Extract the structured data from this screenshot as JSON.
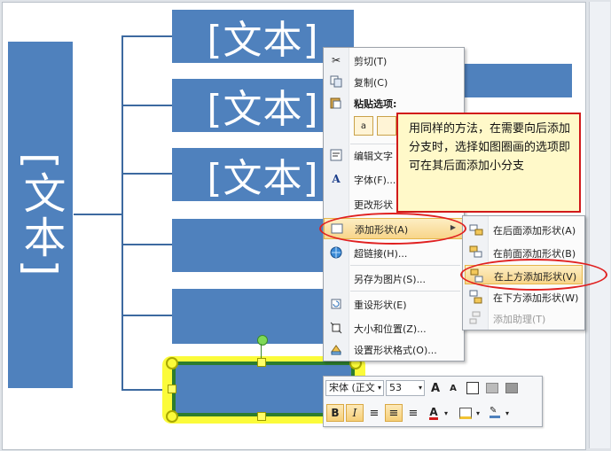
{
  "smartart": {
    "root_text": "[文本]",
    "branch_texts": [
      "[文本]",
      "[文本]",
      "[文本]",
      "",
      "",
      ""
    ]
  },
  "context_menu": {
    "items": [
      {
        "label": "剪切(T)",
        "icon": "scissors-icon"
      },
      {
        "label": "复制(C)",
        "icon": "copy-icon"
      },
      {
        "label": "粘贴选项:",
        "icon": "paste-icon"
      },
      {
        "label": "编辑文字",
        "icon": "edit-text-icon"
      },
      {
        "label": "字体(F)...",
        "icon": "font-icon"
      },
      {
        "label": "更改形状",
        "icon": "change-shape-icon"
      },
      {
        "label": "添加形状(A)",
        "icon": "add-shape-icon"
      },
      {
        "label": "超链接(H)...",
        "icon": "hyperlink-icon"
      },
      {
        "label": "另存为图片(S)...",
        "icon": ""
      },
      {
        "label": "重设形状(E)",
        "icon": "reset-shape-icon"
      },
      {
        "label": "大小和位置(Z)...",
        "icon": "size-position-icon"
      },
      {
        "label": "设置形状格式(O)...",
        "icon": "format-shape-icon"
      }
    ]
  },
  "submenu": {
    "items": [
      {
        "label": "在后面添加形状(A)",
        "disabled": false
      },
      {
        "label": "在前面添加形状(B)",
        "disabled": false
      },
      {
        "label": "在上方添加形状(V)",
        "disabled": false
      },
      {
        "label": "在下方添加形状(W)",
        "disabled": false
      },
      {
        "label": "添加助理(T)",
        "disabled": true
      }
    ]
  },
  "callout": {
    "text": "用同样的方法，在需要向后添加分支时，选择如图圈画的选项即可在其后面添加小分支"
  },
  "mini_toolbar": {
    "font_name": "宋体 (正文",
    "font_size": "53",
    "bold_label": "B",
    "italic_label": "I",
    "grow_label": "A",
    "shrink_label": "A",
    "font_color_label": "A"
  },
  "colors": {
    "shape_fill": "#4f81bd",
    "highlight": "#fbfb3a",
    "annotation_red": "#e02020"
  }
}
